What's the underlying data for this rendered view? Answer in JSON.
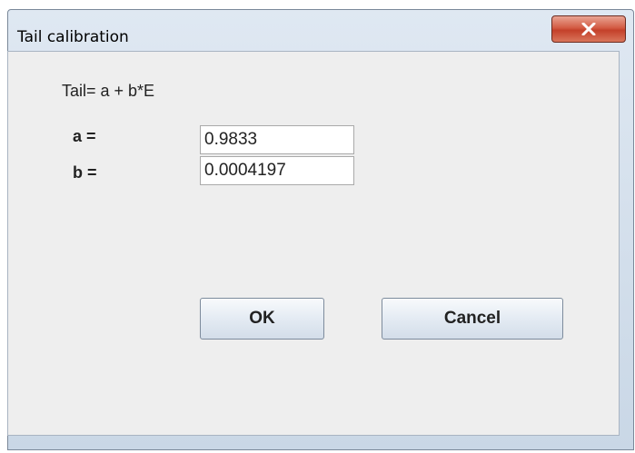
{
  "window": {
    "title": "Tail calibration"
  },
  "dialog": {
    "formula": "Tail=  a + b*E",
    "a_label": "a =",
    "a_value": "0.9833",
    "b_label": "b =",
    "b_value": "0.0004197"
  },
  "buttons": {
    "ok_label": "OK",
    "cancel_label": "Cancel"
  },
  "icons": {
    "close": "close-icon"
  },
  "colors": {
    "close_button": "#c4402a",
    "client_background": "#eeeeee"
  }
}
